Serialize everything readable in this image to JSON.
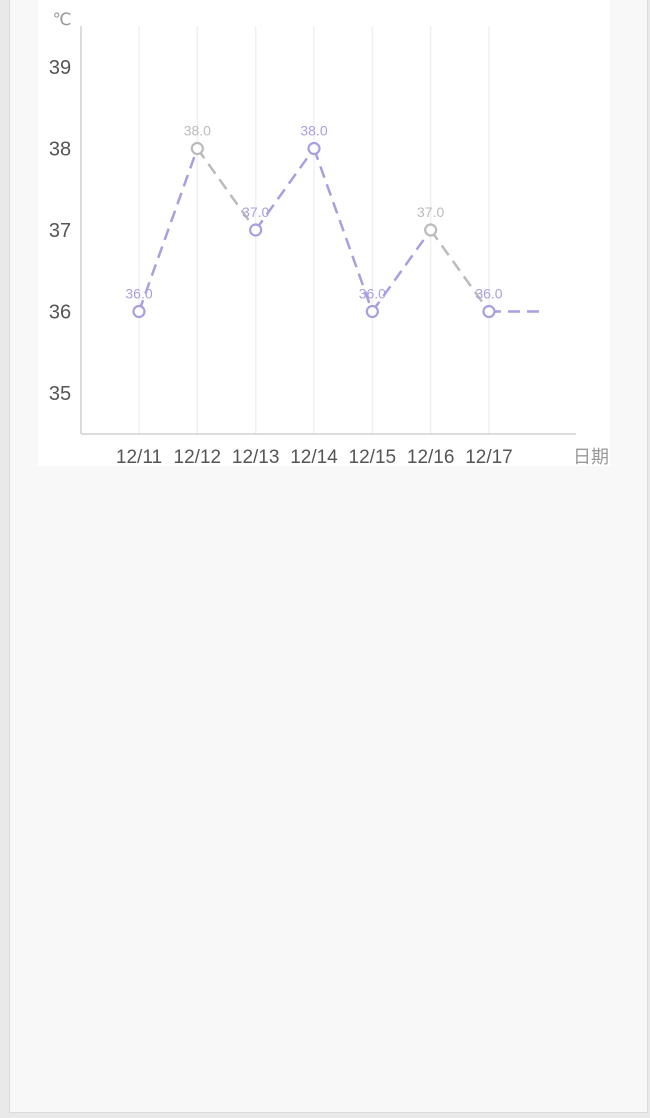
{
  "chart_data": {
    "type": "line",
    "y_unit": "℃",
    "x_unit": "日期",
    "categories": [
      "12/11",
      "12/12",
      "12/13",
      "12/14",
      "12/15",
      "12/16",
      "12/17"
    ],
    "ylim": [
      35,
      39
    ],
    "yticks": [
      39,
      38,
      37,
      36,
      35
    ],
    "values": [
      36.0,
      38.0,
      37.0,
      38.0,
      36.0,
      37.0,
      36.0
    ],
    "value_labels": [
      "36.0",
      "38.0",
      "37.0",
      "38.0",
      "36.0",
      "37.0",
      "36.0"
    ],
    "point_colors": [
      "#a99fe0",
      "#bbbbbb",
      "#a99fe0",
      "#a99fe0",
      "#a99fe0",
      "#bbbbbb",
      "#a99fe0"
    ],
    "segment_colors": [
      "#a99fe0",
      "#bbbbbb",
      "#a99fe0",
      "#a99fe0",
      "#a99fe0",
      "#bbbbbb",
      "#a99fe0"
    ],
    "trailing_segment": true,
    "grid": "vertical",
    "colors": {
      "purple": "#a99fe0",
      "gray": "#bbbbbb",
      "axis": "#d0d0d0",
      "grid": "#f0f0f0",
      "tick_text": "#555555",
      "unit_text": "#999999"
    }
  }
}
